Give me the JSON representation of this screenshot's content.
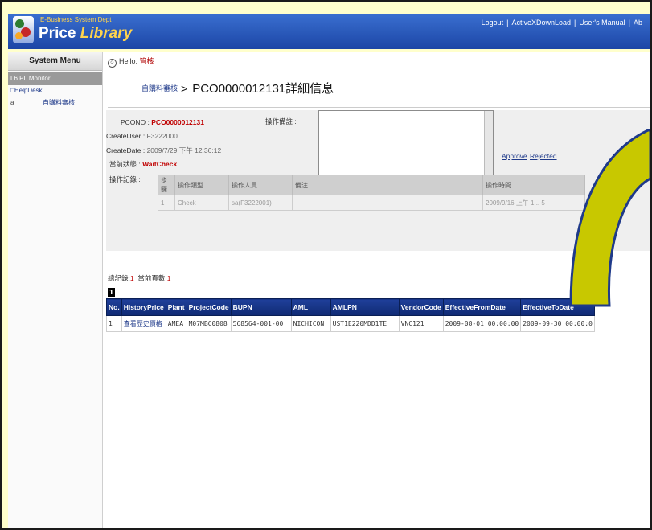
{
  "header": {
    "dept": "E-Business System Dept",
    "title_part1": "Price ",
    "title_part2": "Library",
    "links": [
      "Logout",
      "ActiveXDownLoad",
      "User's Manual",
      "Ab"
    ]
  },
  "sidebar": {
    "title": "System Menu",
    "group": "L6 PL Monitor",
    "item_helpdesk": "HelpDesk",
    "sub_bullet": "a",
    "sub_label": "自購料審核"
  },
  "main": {
    "hello_label": "Hello: ",
    "hello_user": "管核",
    "crumb": "自購料審核",
    "arrow": ">",
    "page_title": "PCO0000012131詳細信息",
    "pcono_label": "PCONO : ",
    "pcono_value": "PCO0000012131",
    "createuser_label": "CreateUser : ",
    "createuser_value": "F3222000",
    "createdate_label": "CreateDate : ",
    "createdate_value": "2009/7/29 下午 12:36:12",
    "status_label": "當前狀態 : ",
    "status_value": "WaitCheck",
    "note_label": "操作備註 :",
    "approve": "Approve",
    "rejected": "Rejected",
    "history_label": "操作記錄 :",
    "history_headers": [
      "步驟",
      "操作類型",
      "操作人員",
      "備注",
      "操作時間"
    ],
    "history_row": [
      "1",
      "Check",
      "sa(F3222001)",
      "",
      "2009/9/16 上午 1... 5"
    ],
    "total_label": "總記錄:",
    "total_value": "1",
    "page_label": "當前頁數:",
    "page_value": "1",
    "page_btn": "1"
  },
  "table": {
    "headers": [
      "No.",
      "HistoryPrice",
      "Plant",
      "ProjectCode",
      "BUPN",
      "AML",
      "AMLPN",
      "VendorCode",
      "EffectiveFromDate",
      "EffectiveToDate"
    ],
    "row": [
      "1",
      "查看歷史價格",
      "AMEA",
      "M07MBC0808",
      "568564-001-00",
      "NICHICON",
      "UST1E220MDD1TE",
      "VNC121",
      "2009-08-01 00:00:00",
      "2009-09-30 00:00:0"
    ]
  },
  "colors": {
    "header_blue": "#1c46a6",
    "accent_yellow": "#ffd34d",
    "annotation_arrow": "#c8c800"
  }
}
